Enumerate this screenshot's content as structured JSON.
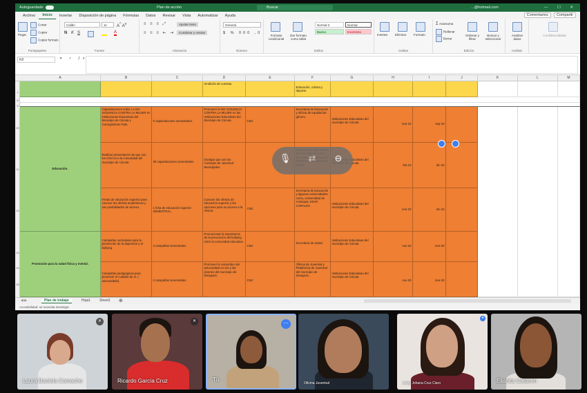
{
  "titlebar": {
    "autosave": "Autoguardado",
    "file": "Plan de acción",
    "search": "Buscar",
    "account": "...@hotmail.com",
    "controls": "— ☐ ✕"
  },
  "menu": {
    "tabs": [
      "Archivo",
      "Inicio",
      "Insertar",
      "Disposición de página",
      "Fórmulas",
      "Datos",
      "Revisar",
      "Vista",
      "Automatizar",
      "Ayuda"
    ],
    "active": 1,
    "comments": "Comentarios",
    "share": "Compartir"
  },
  "ribbon": {
    "paste": "Pegar",
    "cut": "Cortar",
    "copy": "Copiar",
    "format_painter": "Copiar formato",
    "clipboard": "Portapapeles",
    "font_name": "Calibri",
    "font_size": "11",
    "font": "Fuente",
    "wrap": "Ajustar texto",
    "merge": "Combinar y centrar",
    "alignment": "Alineación",
    "number_format": "General",
    "number": "Número",
    "cond_format": "Formato condicional",
    "table_format": "Dar formato como tabla",
    "styles": [
      "Normal 2",
      "Normal",
      "Bueno",
      "Incorrecto"
    ],
    "styles_label": "Estilos",
    "insert": "Insertar",
    "delete": "Eliminar",
    "format": "Formato",
    "cells": "Celdas",
    "autosum": "Autosuma",
    "fill": "Rellenar",
    "clear": "Borrar",
    "sort": "Ordenar y filtrar",
    "find": "Buscar y seleccionar",
    "editing": "Edición",
    "analyze": "Analizar datos",
    "analysis": "Análisis",
    "sensitivity": "Confidencialidad",
    "bold": "N",
    "italic": "K",
    "underline": "S"
  },
  "formula_bar": {
    "name_box": "K8",
    "value": ""
  },
  "sheet": {
    "columns": [
      "A",
      "B",
      "C",
      "D",
      "E",
      "F",
      "G",
      "H",
      "I",
      "J",
      "K",
      "L",
      "M"
    ],
    "row_numbers": [
      "7",
      "8",
      "9",
      "10",
      "11",
      "12",
      "13",
      "14",
      "15"
    ],
    "top_row": {
      "d": "rendición de cuentas.",
      "f": "Educación, cultura y deporte."
    },
    "groups": [
      {
        "label": "Educación."
      },
      {
        "label": "Promoción para la salud física y mental."
      }
    ],
    "rows": [
      {
        "b": "Capacitaciones sobre LA NO VIOLENCIA CONTRA LA MUJER en instituciones Educativas del Municipio de Cúcuta y Corregimiento Palo.",
        "c": "5 capacitaciones semestrales.",
        "d": "Promover la NO VIOLENCIA CONTRA LA MUJER en las Instituciones Educativas del Municipio de Cúcuta.",
        "e": "CMJ",
        "f": "Secretaria de Educación y oficina de equidad de género.",
        "g": "Instituciones Educativas del municipio de Cúcuta",
        "h": "mar-23",
        "i": "sep-23"
      },
      {
        "b": "Realizar presentación de que son los CMJ en a la comunidad del municipio de Cúcuta",
        "c": "30 capacitaciones semestrales.",
        "d": "Divulgar que son los Consejos de Juventud Municipales.",
        "e": "",
        "f": "Instituciones Educativas del municipio Cúcuta y Secretaria de Educación, Plataforma de Juventud (PMJ)",
        "g": "Instituciones Educativas del municipio de Cúcuta",
        "h": "feb-23",
        "i": "dic-23"
      },
      {
        "b": "Ferias de educación superior para conocer las ofertas académicas y sus posibilidades de acceso.",
        "c": "1 feria de educación superior SEMESTRAL.",
        "d": "Conocer las ofertas de educación superior y las opciones para su acceso a la misma.",
        "e": "CMJ",
        "f": "Secretaria de Educación y algunas universidades como, Universidad de Antioquia, ESAP, CORALES",
        "g": "Instituciones Educativas del municipio de Cúcuta",
        "h": "ene-23",
        "i": "dic-23"
      },
      {
        "b": "Campañas normativas para la prevención de la depresión y el bullying.",
        "c": "3 campañas semestrales.",
        "d": "Promocionar la importancia de la prevención del bullying entre la comunidad educativa.",
        "e": "CMJ",
        "f": "Secretaría de Salud.",
        "g": "Instituciones Educativas del municipio de Cúcuta",
        "h": "nov-20",
        "i": "mar-20"
      },
      {
        "b": "Campañas pedagógicas para promover el cuidado de sí. ( autocuidado).",
        "c": "2 campañas semestrales.",
        "d": "Promover la costumbre del autocuidado en los y las jóvenes del municipio de Zaragoza.",
        "e": "CMJ",
        "f": "Oficina de Juventud y Plataforma de Juventud del municipio de Zaragoza.",
        "g": "Instituciones Educativas del municipio de Cúcuta",
        "h": "nov-20",
        "i": "mar-20"
      }
    ],
    "tabs": [
      "Plan de trabajo",
      "Hoja1",
      "Sheet1"
    ],
    "active_tab": 0
  },
  "status": {
    "text": "Accesibilidad: se necesita investigar"
  },
  "participants": [
    {
      "name": "Laura Daniela Camacho",
      "muted": true
    },
    {
      "name": "Ricardo García Cruz",
      "muted": true
    },
    {
      "name": "Tú",
      "muted": false
    },
    {
      "name": "Oficina Juventud",
      "muted": false
    },
    {
      "name": "Leidy Johana Cruz Claro",
      "muted": false
    },
    {
      "name": "Elianita Calderin",
      "muted": false
    }
  ],
  "colors": {
    "orange": "#ee7f33",
    "yellow": "#fcd64b",
    "green": "#9ed07b",
    "excel_green": "#1e6e3e",
    "meet_blue": "#3d7ef0"
  },
  "icons": {
    "mute": "mic-off-icon",
    "more": "more-options-icon",
    "mic_off_big": "mic-off-icon",
    "screen": "present-icon",
    "remove": "remove-icon"
  }
}
